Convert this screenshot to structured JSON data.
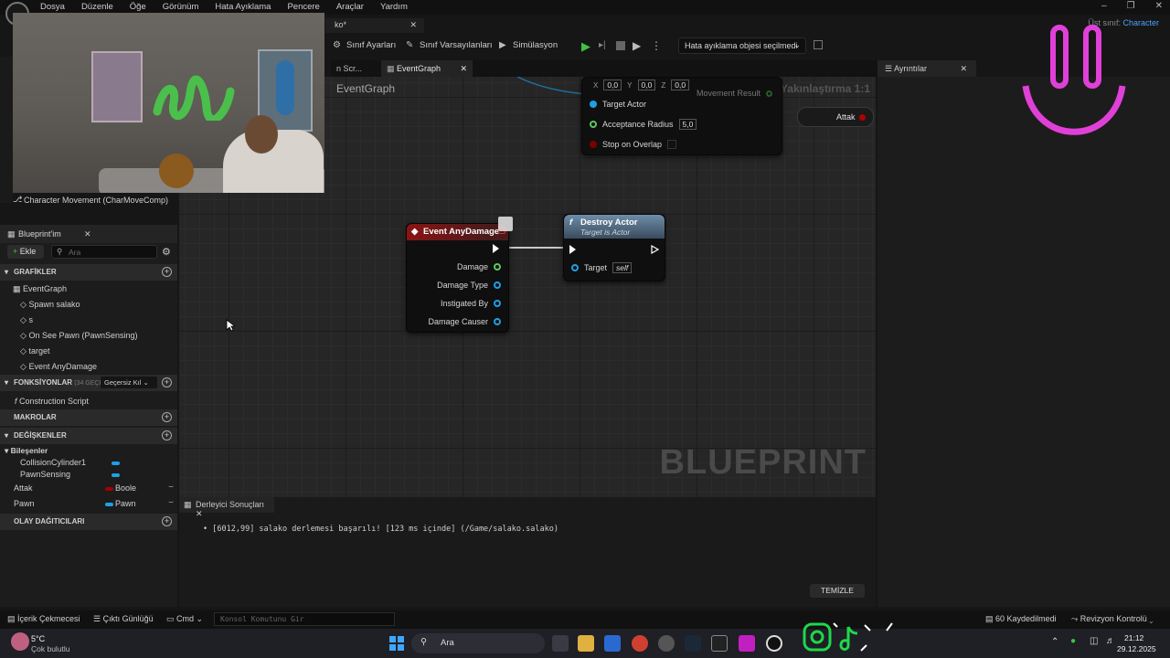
{
  "menu": {
    "items": [
      "Dosya",
      "Düzenle",
      "Öğe",
      "Görünüm",
      "Hata Ayıklama",
      "Pencere",
      "Araçlar",
      "Yardım"
    ]
  },
  "window": {
    "title_fragment": "ko*",
    "parent_class_label": "Üst sınıf:",
    "parent_class_value": "Character"
  },
  "toolbar": {
    "class_settings": "Sınıf Ayarları",
    "class_defaults": "Sınıf Varsayılanları",
    "simulation": "Simülasyon",
    "debug_object": "Hata ayıklama objesi seçilmedi"
  },
  "tabs": {
    "construction_partial": "n Scr...",
    "eventgraph": "EventGraph",
    "details": "Ayrıntılar"
  },
  "graph": {
    "title": "EventGraph",
    "zoom": "Yakınlaştırma 1:1",
    "watermark": "BLUEPRINT",
    "move_node": {
      "vec_x": "0,0",
      "vec_y": "0,0",
      "vec_z": "0,0",
      "movement_result": "Movement Result",
      "target_actor": "Target Actor",
      "acceptance_radius": "Acceptance Radius",
      "acceptance_radius_value": "5,0",
      "stop_on_overlap": "Stop on Overlap"
    },
    "attak_node": "Attak",
    "event_node": {
      "title": "Event AnyDamage",
      "pins": [
        "Damage",
        "Damage Type",
        "Instigated By",
        "Damage Causer"
      ]
    },
    "destroy_node": {
      "title": "Destroy Actor",
      "subtitle": "Target is Actor",
      "target_label": "Target",
      "target_value": "self"
    }
  },
  "left": {
    "components_item": "Character Movement (CharMoveComp)",
    "panel_title": "Blueprint'im",
    "add_button": "Ekle",
    "search_placeholder": "Ara",
    "graphs_header": "GRAFİKLER",
    "graph_items": [
      "EventGraph",
      "Spawn salako",
      "s",
      "On See Pawn (PawnSensing)",
      "target",
      "Event AnyDamage"
    ],
    "functions_header": "FONKSİYONLAR",
    "functions_count": "(34 GEÇERS",
    "override_button": "Geçersiz Kıl",
    "functions_items": [
      "Construction Script"
    ],
    "macros_header": "MAKROLAR",
    "variables_header": "DEĞİŞKENLER",
    "components_header": "Bileşenler",
    "component_vars": [
      "CollisionCylinder1",
      "PawnSensing"
    ],
    "variables": [
      {
        "name": "Attak",
        "type": "Boole",
        "color": "#a30000"
      },
      {
        "name": "Pawn",
        "type": "Pawn",
        "color": "#1ea0e6"
      }
    ],
    "dispatchers_header": "OLAY DAĞITICILARI"
  },
  "compiler": {
    "tab": "Derleyici Sonuçları",
    "message": "[6012,99] salako derlemesi başarılı! [123 ms içinde] (/Game/salako.salako)",
    "clear_button": "TEMİZLE"
  },
  "statusbar": {
    "content_drawer": "İçerik Çekmecesi",
    "output_log": "Çıktı Günlüğü",
    "cmd": "Cmd",
    "console_placeholder": "Konsol Komutunu Gir",
    "unsaved": "60 Kaydedilmedi",
    "revision": "Revizyon Kontrolü"
  },
  "taskbar": {
    "weather_temp": "5°C",
    "weather_desc": "Çok bulutlu",
    "search": "Ara",
    "time": "21:12",
    "date": "29.12.2025"
  },
  "colors": {
    "accent": "#1ea0e6",
    "exec_red": "#a30000",
    "green_pin": "#5cc85c",
    "blue_pin": "#1ea0e6",
    "overlay_pink": "#e040d8"
  }
}
